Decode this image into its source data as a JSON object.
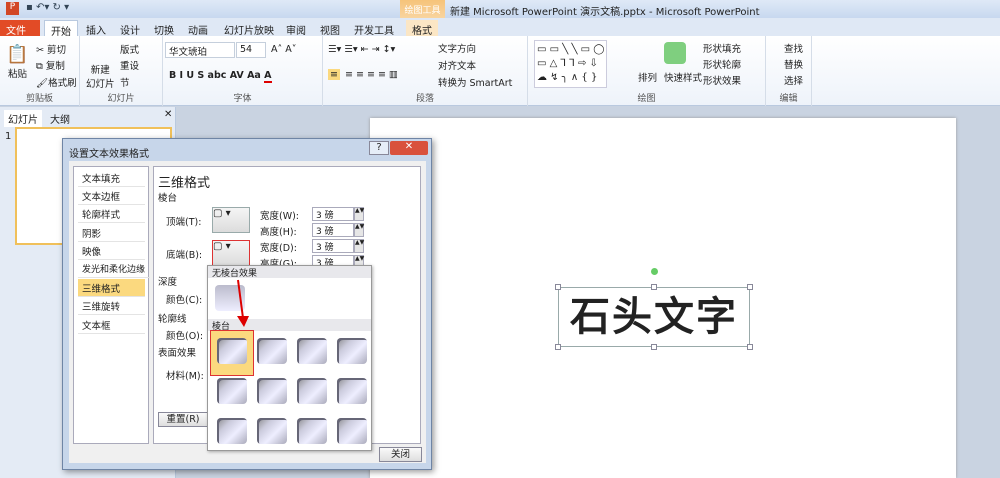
{
  "window": {
    "title": "新建 Microsoft PowerPoint 演示文稿.pptx - Microsoft PowerPoint",
    "context_tab": "绘图工具"
  },
  "tabs": [
    "文件",
    "开始",
    "插入",
    "设计",
    "切换",
    "动画",
    "幻灯片放映",
    "审阅",
    "视图",
    "开发工具",
    "格式"
  ],
  "ribbon": {
    "clipboard": {
      "paste": "粘贴",
      "cut": "剪切",
      "copy": "复制",
      "painter": "格式刷",
      "label": "剪贴板"
    },
    "slides": {
      "new": "新建\n幻灯片",
      "layout": "版式",
      "reset": "重设",
      "section": "节",
      "label": "幻灯片"
    },
    "font": {
      "name": "华文琥珀",
      "size": "54",
      "label": "字体"
    },
    "paragraph": {
      "direction": "文字方向",
      "align": "对齐文本",
      "smartart": "转换为 SmartArt",
      "label": "段落"
    },
    "drawing": {
      "arrange": "排列",
      "quick_styles": "快速样式",
      "fill": "形状填充",
      "outline": "形状轮廓",
      "effects": "形状效果",
      "label": "绘图"
    },
    "editing": {
      "find": "查找",
      "replace": "替换",
      "select": "选择",
      "label": "编辑"
    }
  },
  "left_panel": {
    "tabs": [
      "幻灯片",
      "大纲"
    ],
    "slide_number": "1"
  },
  "slide": {
    "text": "石头文字"
  },
  "dialog": {
    "title": "设置文本效果格式",
    "categories": [
      "文本填充",
      "文本边框",
      "轮廓样式",
      "阴影",
      "映像",
      "发光和柔化边缘",
      "三维格式",
      "三维旋转",
      "文本框"
    ],
    "selected_category": "三维格式",
    "heading": "三维格式",
    "bevel_section": "棱台",
    "top_label": "顶端(T):",
    "bottom_label": "底端(B):",
    "top_width_label": "宽度(W):",
    "top_width": "3 磅",
    "top_height_label": "高度(H):",
    "top_height": "3 磅",
    "bottom_width_label": "宽度(D):",
    "bottom_width": "3 磅",
    "bottom_height_label": "高度(G):",
    "bottom_height": "3 磅",
    "depth_section": "深度",
    "depth_color": "颜色(C):",
    "contour_section": "轮廓线",
    "contour_color": "颜色(O):",
    "surface_section": "表面效果",
    "material": "材料(M):",
    "reset": "重置(R)",
    "close": "关闭",
    "popup": {
      "no_bevel": "无棱台效果",
      "bevel": "棱台"
    }
  }
}
